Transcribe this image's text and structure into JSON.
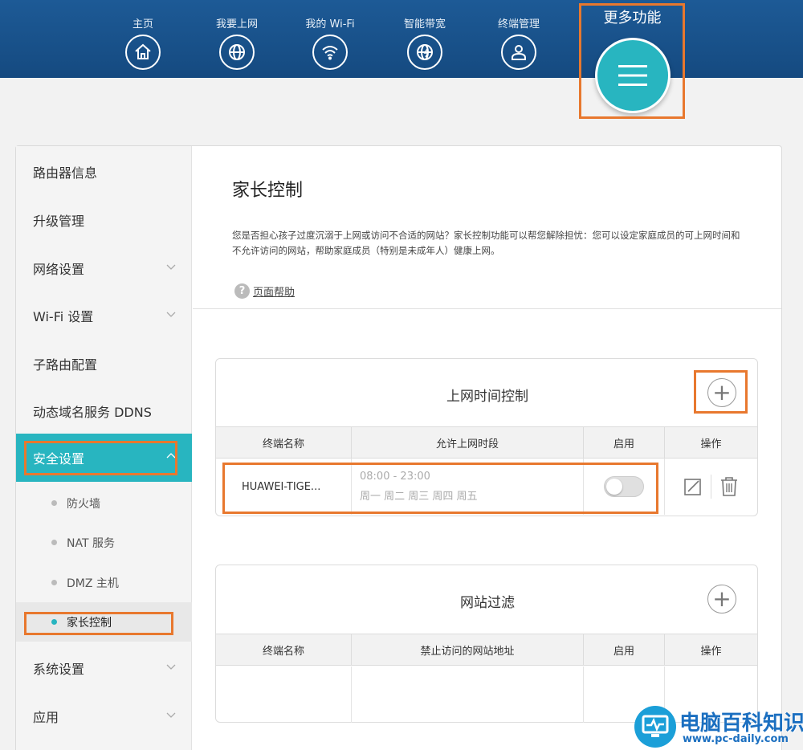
{
  "nav": {
    "items": [
      {
        "label": "主页",
        "icon": "home-icon"
      },
      {
        "label": "我要上网",
        "icon": "globe-icon"
      },
      {
        "label": "我的 Wi-Fi",
        "icon": "wifi-icon"
      },
      {
        "label": "智能带宽",
        "icon": "bandwidth-icon"
      },
      {
        "label": "终端管理",
        "icon": "user-icon"
      }
    ],
    "more_label": "更多功能",
    "more_icon": "menu-icon"
  },
  "sidebar": {
    "items": [
      {
        "label": "路由器信息"
      },
      {
        "label": "升级管理"
      },
      {
        "label": "网络设置",
        "expandable": true
      },
      {
        "label": "Wi-Fi 设置",
        "expandable": true
      },
      {
        "label": "子路由配置"
      },
      {
        "label": "动态域名服务 DDNS"
      },
      {
        "label": "安全设置",
        "expandable": true,
        "active": true
      },
      {
        "label": "系统设置",
        "expandable": true
      },
      {
        "label": "应用",
        "expandable": true
      }
    ],
    "sub_items": [
      {
        "label": "防火墙"
      },
      {
        "label": "NAT 服务"
      },
      {
        "label": "DMZ 主机"
      },
      {
        "label": "家长控制",
        "active": true
      }
    ]
  },
  "main": {
    "title": "家长控制",
    "description": "您是否担心孩子过度沉溺于上网或访问不合适的网站？家长控制功能可以帮您解除担忧：您可以设定家庭成员的可上网时间和不允许访问的网站，帮助家庭成员（特别是未成年人）健康上网。",
    "help_label": "页面帮助",
    "help_icon": "question-icon"
  },
  "time_control": {
    "title": "上网时间控制",
    "add_icon": "plus-icon",
    "columns": [
      "终端名称",
      "允许上网时段",
      "启用",
      "操作"
    ],
    "rows": [
      {
        "device": "HUAWEI-TIGE...",
        "time": "08:00 - 23:00",
        "days": "周一 周二 周三 周四 周五",
        "enabled": false
      }
    ]
  },
  "site_filter": {
    "title": "网站过滤",
    "add_icon": "plus-icon",
    "columns": [
      "终端名称",
      "禁止访问的网站地址",
      "启用",
      "操作"
    ]
  },
  "watermark": {
    "text": "电脑百科知识",
    "url": "www.pc-daily.com"
  },
  "colors": {
    "header": "#1d5a96",
    "accent": "#28b5c0",
    "highlight": "#e8782e"
  }
}
